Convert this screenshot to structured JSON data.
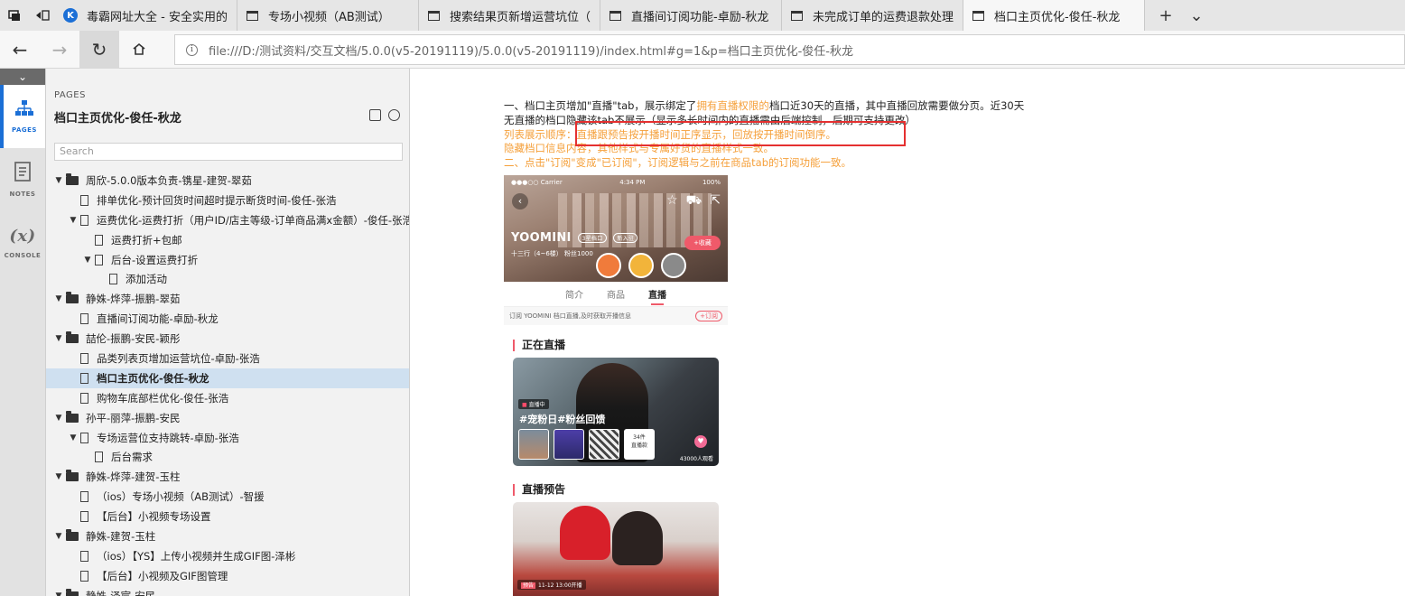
{
  "browser": {
    "tabs": [
      {
        "title": "毒霸网址大全 - 安全实用的",
        "icon": "k-logo-icon",
        "active": false
      },
      {
        "title": "专场小视频（AB测试）",
        "icon": "page-icon",
        "active": false
      },
      {
        "title": "搜索结果页新增运营坑位（",
        "icon": "page-icon",
        "active": false
      },
      {
        "title": "直播间订阅功能-卓励-秋龙",
        "icon": "page-icon",
        "active": false
      },
      {
        "title": "未完成订单的运费退款处理",
        "icon": "page-icon",
        "active": false
      },
      {
        "title": "档口主页优化-俊任-秋龙",
        "icon": "page-icon",
        "active": true
      }
    ],
    "address": "file:///D:/测试资料/交互文档/5.0.0(v5-20191119)/5.0.0(v5-20191119)/index.html#g=1&p=档口主页优化-俊任-秋龙"
  },
  "rail": {
    "items": [
      {
        "label": "PAGES",
        "icon": "sitemap-icon",
        "active": true
      },
      {
        "label": "NOTES",
        "icon": "notes-icon",
        "active": false
      },
      {
        "label": "CONSOLE",
        "icon": "variable-icon",
        "active": false
      }
    ]
  },
  "sitemap": {
    "heading": "PAGES",
    "title": "档口主页优化-俊任-秋龙",
    "search_placeholder": "Search",
    "nodes": [
      {
        "label": "周欣-5.0.0版本负责-镌星-建贺-翠茹",
        "type": "folder",
        "level": 0,
        "expanded": true
      },
      {
        "label": "排单优化-预计回货时间超时提示断货时间-俊任-张浩",
        "type": "page",
        "level": 1
      },
      {
        "label": "运费优化-运费打折（用户ID/店主等级-订单商品满x金额）-俊任-张浩",
        "type": "page",
        "level": 1,
        "expanded": true
      },
      {
        "label": "运费打折+包邮",
        "type": "page",
        "level": 2
      },
      {
        "label": "后台-设置运费打折",
        "type": "page",
        "level": 2,
        "expanded": true
      },
      {
        "label": "添加活动",
        "type": "page",
        "level": 3
      },
      {
        "label": "静姝-烨萍-振鹏-翠茹",
        "type": "folder",
        "level": 0,
        "expanded": true
      },
      {
        "label": "直播间订阅功能-卓励-秋龙",
        "type": "page",
        "level": 1
      },
      {
        "label": "喆伦-振鹏-安民-颖彤",
        "type": "folder",
        "level": 0,
        "expanded": true
      },
      {
        "label": "品类列表页增加运营坑位-卓励-张浩",
        "type": "page",
        "level": 1
      },
      {
        "label": "档口主页优化-俊任-秋龙",
        "type": "page",
        "level": 1,
        "selected": true
      },
      {
        "label": "购物车底部栏优化-俊任-张浩",
        "type": "page",
        "level": 1
      },
      {
        "label": "孙平-丽萍-振鹏-安民",
        "type": "folder",
        "level": 0,
        "expanded": true
      },
      {
        "label": "专场运营位支持跳转-卓励-张浩",
        "type": "page",
        "level": 1,
        "expanded": true
      },
      {
        "label": "后台需求",
        "type": "page",
        "level": 2
      },
      {
        "label": "静姝-烨萍-建贺-玉柱",
        "type": "folder",
        "level": 0,
        "expanded": true
      },
      {
        "label": "（ios）专场小视频（AB测试）-智援",
        "type": "page",
        "level": 1
      },
      {
        "label": "【后台】小视频专场设置",
        "type": "page",
        "level": 1
      },
      {
        "label": "静姝-建贺-玉柱",
        "type": "folder",
        "level": 0,
        "expanded": true
      },
      {
        "label": "（ios）【YS】上传小视频并生成GIF图-泽彬",
        "type": "page",
        "level": 1
      },
      {
        "label": "【后台】小视频及GIF图管理",
        "type": "page",
        "level": 1
      },
      {
        "label": "静姝-泽宸-安民",
        "type": "folder",
        "level": 0,
        "expanded": true
      }
    ]
  },
  "notes": {
    "line1_a": "一、档口主页增加\"直播\"tab，展示绑定了",
    "line1_b": "拥有直播权限的",
    "line1_c": "档口近30天的直播，其中直播回放需要做分页。近30天",
    "line2": "无直播的档口隐藏该tab不展示（显示多长时间内的直播需由后端控制，后期可支持更改）",
    "line3": "列表展示顺序：直播跟预告按开播时间正序显示，回放按开播时间倒序。",
    "line4": "隐藏档口信息内容，其他样式与专属好货的直播样式一致。",
    "line5": "二、点击\"订阅\"变成\"已订阅\"，订阅逻辑与之前在商品tab的订阅功能一致。",
    "colors": {
      "highlight": "#f5a03b",
      "box": "#e53030"
    }
  },
  "phone": {
    "status_carrier": "●●●○○ Carrier",
    "status_time": "4:34 PM",
    "status_battery": "100%",
    "shop_name": "YOOMINI",
    "shop_tag1": "3星档口",
    "shop_tag2": "新入驻",
    "shop_sub": "十三行（4~6楼）  粉丝1000",
    "fav_button": "+收藏",
    "tabs": [
      "简介",
      "商品",
      "直播"
    ],
    "subscribe_text": "订阅 YOOMINI 档口直播,及时获取开播信息",
    "subscribe_button": "+订阅",
    "live_section": "正在直播",
    "live_badge_dot": "■",
    "live_badge": "直播中",
    "live_title": "#宠粉日#粉丝回馈",
    "live_count_num": "34件",
    "live_count_label": "直播款",
    "live_viewers": "43000人观看",
    "preview_section": "直播预告",
    "preview_tag": "预告",
    "preview_time": "11-12 13:00开播"
  }
}
